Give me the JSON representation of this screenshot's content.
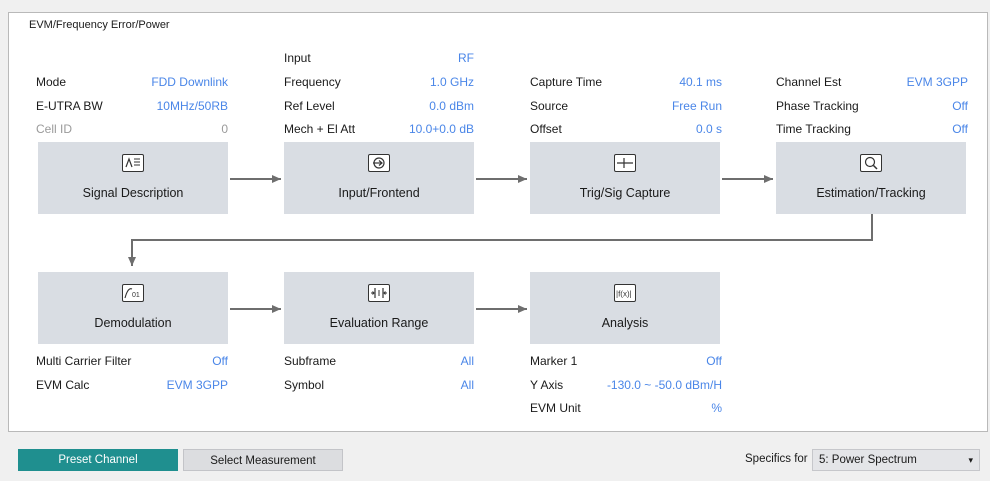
{
  "frame_title": "EVM/Frequency Error/Power",
  "col1_top": [
    {
      "k": "Mode",
      "v": "FDD Downlink"
    },
    {
      "k": "E-UTRA BW",
      "v": "10MHz/50RB"
    },
    {
      "k": "Cell ID",
      "v": "0"
    }
  ],
  "col2_top": [
    {
      "k": "Input",
      "v": "RF"
    },
    {
      "k": "Frequency",
      "v": "1.0 GHz"
    },
    {
      "k": "Ref Level",
      "v": "0.0 dBm"
    },
    {
      "k": "Mech + El Att",
      "v": "10.0+0.0 dB"
    }
  ],
  "col3_top": [
    {
      "k": "Capture Time",
      "v": "40.1 ms"
    },
    {
      "k": "Source",
      "v": "Free Run"
    },
    {
      "k": "Offset",
      "v": "0.0 s"
    }
  ],
  "col4_top": [
    {
      "k": "Channel Est",
      "v": "EVM 3GPP"
    },
    {
      "k": "Phase Tracking",
      "v": "Off"
    },
    {
      "k": "Time Tracking",
      "v": "Off"
    }
  ],
  "blocks": {
    "signal_description": {
      "label": "Signal Description",
      "icon": "signal-description-icon"
    },
    "input_frontend": {
      "label": "Input/Frontend",
      "icon": "input-frontend-icon"
    },
    "trig_sig_capture": {
      "label": "Trig/Sig Capture",
      "icon": "trigger-capture-icon"
    },
    "estimation_tracking": {
      "label": "Estimation/Tracking",
      "icon": "estimation-tracking-icon"
    },
    "demodulation": {
      "label": "Demodulation",
      "icon": "demodulation-icon"
    },
    "evaluation_range": {
      "label": "Evaluation Range",
      "icon": "evaluation-range-icon"
    },
    "analysis": {
      "label": "Analysis",
      "icon": "analysis-icon"
    }
  },
  "col1_bottom": [
    {
      "k": "Multi Carrier Filter",
      "v": "Off"
    },
    {
      "k": "EVM Calc",
      "v": "EVM 3GPP"
    }
  ],
  "col2_bottom": [
    {
      "k": "Subframe",
      "v": "All"
    },
    {
      "k": "Symbol",
      "v": "All"
    }
  ],
  "col3_bottom": [
    {
      "k": "Marker 1",
      "v": "Off"
    },
    {
      "k": "Y Axis",
      "v": "-130.0 ~ -50.0 dBm/H"
    },
    {
      "k": "EVM Unit",
      "v": "%"
    }
  ],
  "icons": {
    "analysis_glyph": "|f(x)|",
    "demod_glyph": "01"
  },
  "footer": {
    "preset_channel": "Preset Channel",
    "select_measurement": "Select Measurement",
    "specifics_label": "Specifics for",
    "specifics_value": "5: Power Spectrum",
    "caret": "▾"
  },
  "colors": {
    "value_blue": "#4a86e8",
    "block_bg": "#d9dde3",
    "primary_button": "#1f8f8f",
    "dim_text": "#9a9a9a"
  }
}
